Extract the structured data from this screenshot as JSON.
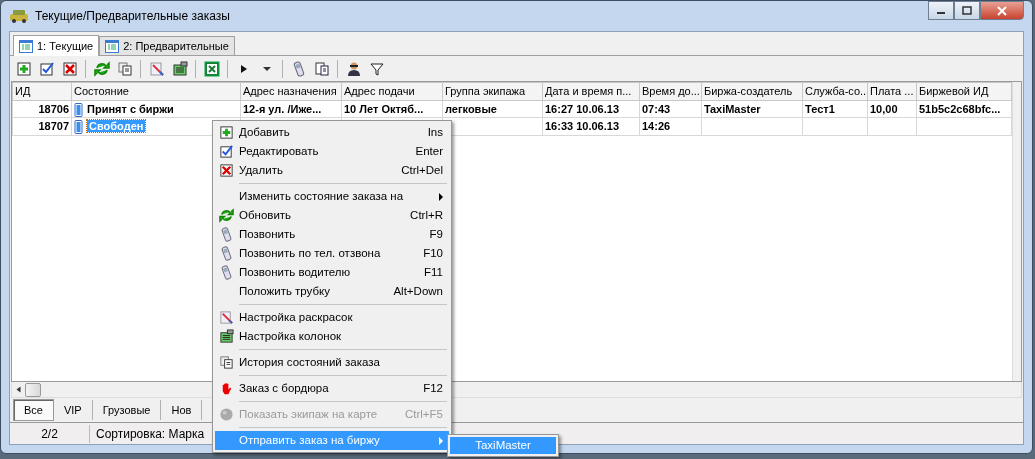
{
  "window": {
    "title": "Текущие/Предварительные заказы"
  },
  "tabs": [
    {
      "label": "1: Текущие",
      "selected": true
    },
    {
      "label": "2: Предварительные",
      "selected": false
    }
  ],
  "table": {
    "columns": [
      "ИД",
      "Состояние",
      "Адрес назначения",
      "Адрес подачи",
      "Группа экипажа",
      "Дата и время п...",
      "Время до...",
      "Биржа-создатель",
      "Служба-со...",
      "Плата ...",
      "Биржевой ИД"
    ],
    "rows": [
      {
        "selected": false,
        "cells": [
          "18706",
          "Принят с биржи",
          "12-я ул. /Иже...",
          "10 Лет Октяб...",
          "легковые",
          "16:27 10.06.13",
          "07:43",
          "TaxiMaster",
          "Тест1",
          "10,00",
          "51b5c2c68bfc..."
        ]
      },
      {
        "selected": true,
        "cells": [
          "18707",
          "Свободен",
          "",
          "",
          "",
          "16:33 10.06.13",
          "14:26",
          "",
          "",
          "",
          ""
        ]
      }
    ]
  },
  "filter_tabs": [
    {
      "label": "Все",
      "selected": true
    },
    {
      "label": "VIP",
      "selected": false
    },
    {
      "label": "Грузовые",
      "selected": false
    },
    {
      "label": "Нов",
      "selected": false
    }
  ],
  "status_bar": {
    "count": "2/2",
    "sort": "Сортировка: Марка"
  },
  "context_menu": [
    {
      "kind": "item",
      "label": "Добавить",
      "shortcut": "Ins",
      "disabled": false,
      "selected": false,
      "submenu": false
    },
    {
      "kind": "item",
      "label": "Редактировать",
      "shortcut": "Enter",
      "disabled": false,
      "selected": false,
      "submenu": false
    },
    {
      "kind": "item",
      "label": "Удалить",
      "shortcut": "Ctrl+Del",
      "disabled": false,
      "selected": false,
      "submenu": false
    },
    {
      "kind": "separator"
    },
    {
      "kind": "item",
      "label": "Изменить состояние заказа на",
      "disabled": false,
      "selected": false,
      "submenu": true
    },
    {
      "kind": "item",
      "label": "Обновить",
      "shortcut": "Ctrl+R",
      "disabled": false,
      "selected": false,
      "submenu": false
    },
    {
      "kind": "item",
      "label": "Позвонить",
      "shortcut": "F9",
      "disabled": false,
      "selected": false,
      "submenu": false
    },
    {
      "kind": "item",
      "label": "Позвонить по тел. отзвона",
      "shortcut": "F10",
      "disabled": false,
      "selected": false,
      "submenu": false
    },
    {
      "kind": "item",
      "label": "Позвонить водителю",
      "shortcut": "F11",
      "disabled": false,
      "selected": false,
      "submenu": false
    },
    {
      "kind": "item",
      "label": "Положить трубку",
      "shortcut": "Alt+Down",
      "disabled": false,
      "selected": false,
      "submenu": false
    },
    {
      "kind": "separator"
    },
    {
      "kind": "item",
      "label": "Настройка раскрасок",
      "disabled": false,
      "selected": false,
      "submenu": false
    },
    {
      "kind": "item",
      "label": "Настройка колонок",
      "disabled": false,
      "selected": false,
      "submenu": false
    },
    {
      "kind": "separator"
    },
    {
      "kind": "item",
      "label": "История состояний заказа",
      "disabled": false,
      "selected": false,
      "submenu": false
    },
    {
      "kind": "separator"
    },
    {
      "kind": "item",
      "label": "Заказ с бордюра",
      "shortcut": "F12",
      "disabled": false,
      "selected": false,
      "submenu": false
    },
    {
      "kind": "separator"
    },
    {
      "kind": "item",
      "label": "Показать экипаж на карте",
      "shortcut": "Ctrl+F5",
      "disabled": true,
      "selected": false,
      "submenu": false
    },
    {
      "kind": "separator"
    },
    {
      "kind": "item",
      "label": "Отправить заказ на биржу",
      "disabled": false,
      "selected": true,
      "submenu": true
    }
  ],
  "submenu": [
    {
      "label": "TaxiMaster",
      "selected": true
    }
  ]
}
